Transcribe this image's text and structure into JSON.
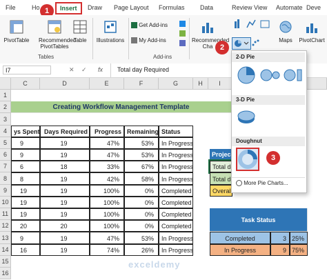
{
  "tabs": [
    "File",
    "Ho",
    "Insert",
    "Draw",
    "Page Layout",
    "Formulas",
    "Data",
    "Review",
    "View",
    "Automate",
    "Deve"
  ],
  "ribbon": {
    "pivottable": "PivotTable",
    "recommended_pivot": "Recommended PivotTables",
    "table": "Table",
    "tables_group": "Tables",
    "illustrations": "Illustrations",
    "get_addins": "Get Add-ins",
    "my_addins": "My Add-ins",
    "addins_group": "Add-ins",
    "recommended_charts": "Recommended Cha",
    "maps": "Maps",
    "pivotchart": "PivotChart"
  },
  "formula_bar": {
    "name_box": "I7",
    "fx": "fx",
    "content": "Total day Required"
  },
  "columns": [
    "C",
    "D",
    "E",
    "F",
    "G",
    "H",
    "I"
  ],
  "rows": [
    "1",
    "2",
    "3",
    "4",
    "5",
    "6",
    "7",
    "8",
    "9",
    "10",
    "11",
    "12",
    "13",
    "14",
    "15",
    "16"
  ],
  "title": "Creating Workflow Management Template",
  "table": {
    "headers": [
      "ys Spent",
      "Days Required",
      "Progress",
      "Remaining",
      "Status"
    ],
    "rows": [
      [
        "9",
        "19",
        "47%",
        "53%",
        "In Progress"
      ],
      [
        "9",
        "19",
        "47%",
        "53%",
        "In Progress"
      ],
      [
        "6",
        "18",
        "33%",
        "67%",
        "In Progress"
      ],
      [
        "8",
        "19",
        "42%",
        "58%",
        "In Progress"
      ],
      [
        "19",
        "19",
        "100%",
        "0%",
        "Completed"
      ],
      [
        "19",
        "19",
        "100%",
        "0%",
        "Completed"
      ],
      [
        "19",
        "19",
        "100%",
        "0%",
        "Completed"
      ],
      [
        "20",
        "20",
        "100%",
        "0%",
        "Completed"
      ],
      [
        "9",
        "19",
        "47%",
        "53%",
        "In Progress"
      ],
      [
        "16",
        "19",
        "74%",
        "26%",
        "In Progress"
      ]
    ]
  },
  "project": {
    "header": "Projec",
    "r1": "Total da",
    "r2": "Total d",
    "r3": "Overal"
  },
  "task_status": {
    "title": "Task Status",
    "rows": [
      [
        "Completed",
        "3",
        "25%"
      ],
      [
        "In Progress",
        "9",
        "75%"
      ]
    ]
  },
  "dropdown": {
    "twod": "2-D Pie",
    "threed": "3-D Pie",
    "doughnut": "Doughnut",
    "more": "More Pie Charts..."
  },
  "badges": [
    "1",
    "2",
    "3"
  ],
  "watermark": "exceldemy",
  "colors": {
    "title_bg": "#a9d08e",
    "header_blue": "#2e75b6",
    "orange": "#f4b183",
    "yellow": "#ffd966",
    "blue_light": "#9dc3e6",
    "badge": "#d32f2f"
  }
}
